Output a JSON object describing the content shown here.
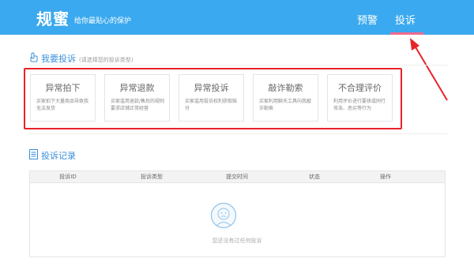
{
  "header": {
    "logo": "规蜜",
    "tagline": "给你最贴心的保护",
    "nav": [
      "预警",
      "投诉"
    ]
  },
  "complain": {
    "title": "我要投诉",
    "hint": "(请选择您的投诉类型)",
    "cards": [
      {
        "title": "异常拍下",
        "desc": "买家拍下大量商品导致我无法发货"
      },
      {
        "title": "异常退款",
        "desc": "买家滥用退款/售后的规则要求店铺正常经营"
      },
      {
        "title": "异常投诉",
        "desc": "买家滥用投诉权利获取赔付"
      },
      {
        "title": "敲诈勒索",
        "desc": "买家利用聊天工具向我敲诈勒索"
      },
      {
        "title": "不合理评价",
        "desc": "利用评价进行要挟或同行攻击、恶劣等行为"
      }
    ]
  },
  "records": {
    "title": "投诉记录",
    "columns": [
      "投诉ID",
      "投诉类型",
      "提交时间",
      "状态",
      "操作"
    ],
    "empty": "您还没有过任何投诉"
  },
  "colors": {
    "header": "#3aa9ef",
    "accent": "#3a8fd9",
    "highlight": "#e8232a",
    "underline": "#f06a8d"
  }
}
